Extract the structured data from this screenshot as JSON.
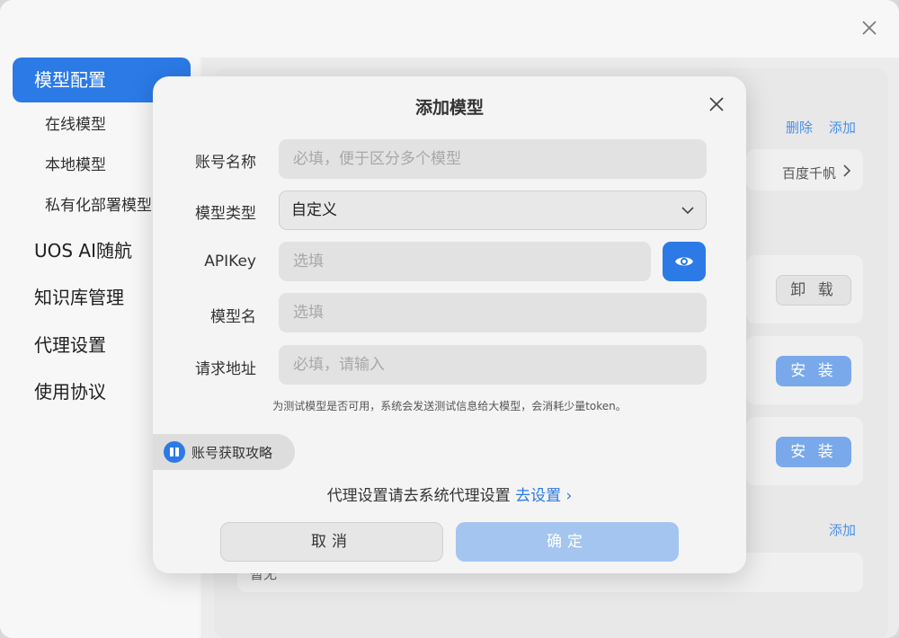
{
  "sidebar": {
    "items": [
      {
        "label": "模型配置"
      },
      {
        "label": "在线模型"
      },
      {
        "label": "本地模型"
      },
      {
        "label": "私有化部署模型"
      },
      {
        "label": "UOS AI随航"
      },
      {
        "label": "知识库管理"
      },
      {
        "label": "代理设置"
      },
      {
        "label": "使用协议"
      }
    ]
  },
  "background": {
    "delete_link": "删除",
    "add_link_1": "添加",
    "provider_value": "百度千帆",
    "uninstall_button": "卸 载",
    "install_button_1": "安 装",
    "install_button_2": "安 装",
    "add_link_2": "添加",
    "bottom_card_text": "暂无"
  },
  "dialog": {
    "title": "添加模型",
    "account_name": {
      "label": "账号名称",
      "placeholder": "必填，便于区分多个模型"
    },
    "model_type": {
      "label": "模型类型",
      "value": "自定义"
    },
    "api_key": {
      "label": "APIKey",
      "placeholder": "选填"
    },
    "model_name": {
      "label": "模型名",
      "placeholder": "选填"
    },
    "request_url": {
      "label": "请求地址",
      "placeholder": "必填，请输入"
    },
    "note": "为测试模型是否可用，系统会发送测试信息给大模型，会消耗少量token。",
    "guide_chip": "账号获取攻略",
    "proxy_text": "代理设置请去系统代理设置",
    "proxy_link": "去设置",
    "proxy_link_chevron": "›",
    "cancel_button": "取消",
    "confirm_button": "确定"
  },
  "colors": {
    "accent": "#2b7ae6",
    "accent_disabled": "#a4c5f0"
  }
}
